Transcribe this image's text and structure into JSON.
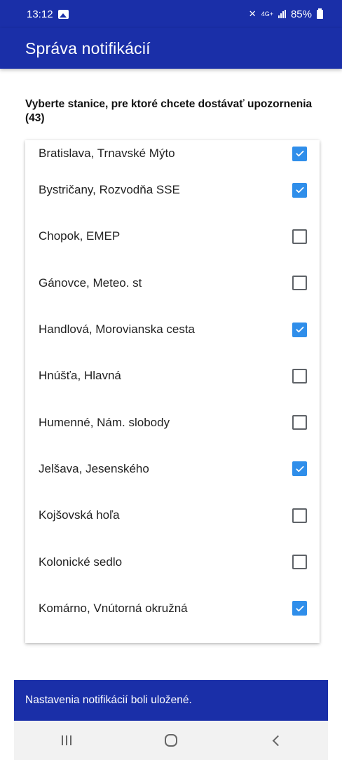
{
  "status_bar": {
    "time": "13:12",
    "network_label": "4G+",
    "battery": "85%"
  },
  "app_bar": {
    "title": "Správa notifikácií"
  },
  "section": {
    "heading": "Vyberte stanice, pre ktoré chcete dostávať upozornenia (43)"
  },
  "stations": [
    {
      "name": "Bratislava, Trnavské Mýto",
      "checked": true
    },
    {
      "name": "Bystričany, Rozvodňa SSE",
      "checked": true
    },
    {
      "name": "Chopok, EMEP",
      "checked": false
    },
    {
      "name": "Gánovce, Meteo. st",
      "checked": false
    },
    {
      "name": "Handlová, Morovianska cesta",
      "checked": true
    },
    {
      "name": "Hnúšťa, Hlavná",
      "checked": false
    },
    {
      "name": "Humenné, Nám. slobody",
      "checked": false
    },
    {
      "name": "Jelšava, Jesenského",
      "checked": true
    },
    {
      "name": "Kojšovská hoľa",
      "checked": false
    },
    {
      "name": "Kolonické sedlo",
      "checked": false
    },
    {
      "name": "Komárno, Vnútorná okružná",
      "checked": true
    }
  ],
  "snackbar": {
    "message": "Nastavenia notifikácií boli uložené."
  },
  "colors": {
    "primary": "#1a2fa8",
    "checkbox_checked": "#2f8eea",
    "checkbox_unchecked_border": "#5f6368"
  },
  "icons": {
    "gallery": "gallery-icon",
    "mute": "mute-icon",
    "signal": "signal-icon",
    "battery": "battery-icon",
    "recents": "recents-icon",
    "home": "home-icon",
    "back": "back-icon"
  }
}
